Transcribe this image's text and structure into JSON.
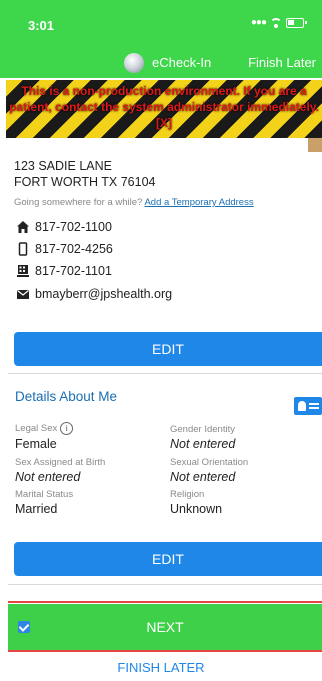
{
  "status_bar": {
    "time": "3:01"
  },
  "header": {
    "app_title": "eCheck-In",
    "finish_later": "Finish Later"
  },
  "warning_banner": {
    "text": "This is a non-production environment. If you are a patient, contact the system administrator immediately. [X]"
  },
  "contact": {
    "address_line1": "123 SADIE LANE",
    "address_line2": "FORT WORTH TX 76104",
    "temp_prompt": "Going somewhere for a while?",
    "temp_link": "Add a Temporary Address",
    "phones": [
      {
        "icon": "home-phone-icon",
        "number": "817-702-1100"
      },
      {
        "icon": "mobile-phone-icon",
        "number": "817-702-4256"
      },
      {
        "icon": "work-phone-icon",
        "number": "817-702-1101"
      }
    ],
    "email": "bmayberr@jpshealth.org",
    "edit_label": "EDIT"
  },
  "details": {
    "title": "Details About Me",
    "fields": {
      "legal_sex": {
        "label": "Legal Sex",
        "value": "Female"
      },
      "gender_identity": {
        "label": "Gender Identity",
        "value": "Not entered"
      },
      "sex_assigned_at_birth": {
        "label": "Sex Assigned at Birth",
        "value": "Not entered"
      },
      "sexual_orientation": {
        "label": "Sexual Orientation",
        "value": "Not entered"
      },
      "marital_status": {
        "label": "Marital Status",
        "value": "Married"
      },
      "religion": {
        "label": "Religion",
        "value": "Unknown"
      }
    },
    "edit_label": "EDIT"
  },
  "footer": {
    "next_label": "NEXT",
    "finish_later_label": "FINISH LATER"
  },
  "colors": {
    "header_green": "#3ed64a",
    "primary_blue": "#1f87e8",
    "warning_red": "#e01818"
  }
}
